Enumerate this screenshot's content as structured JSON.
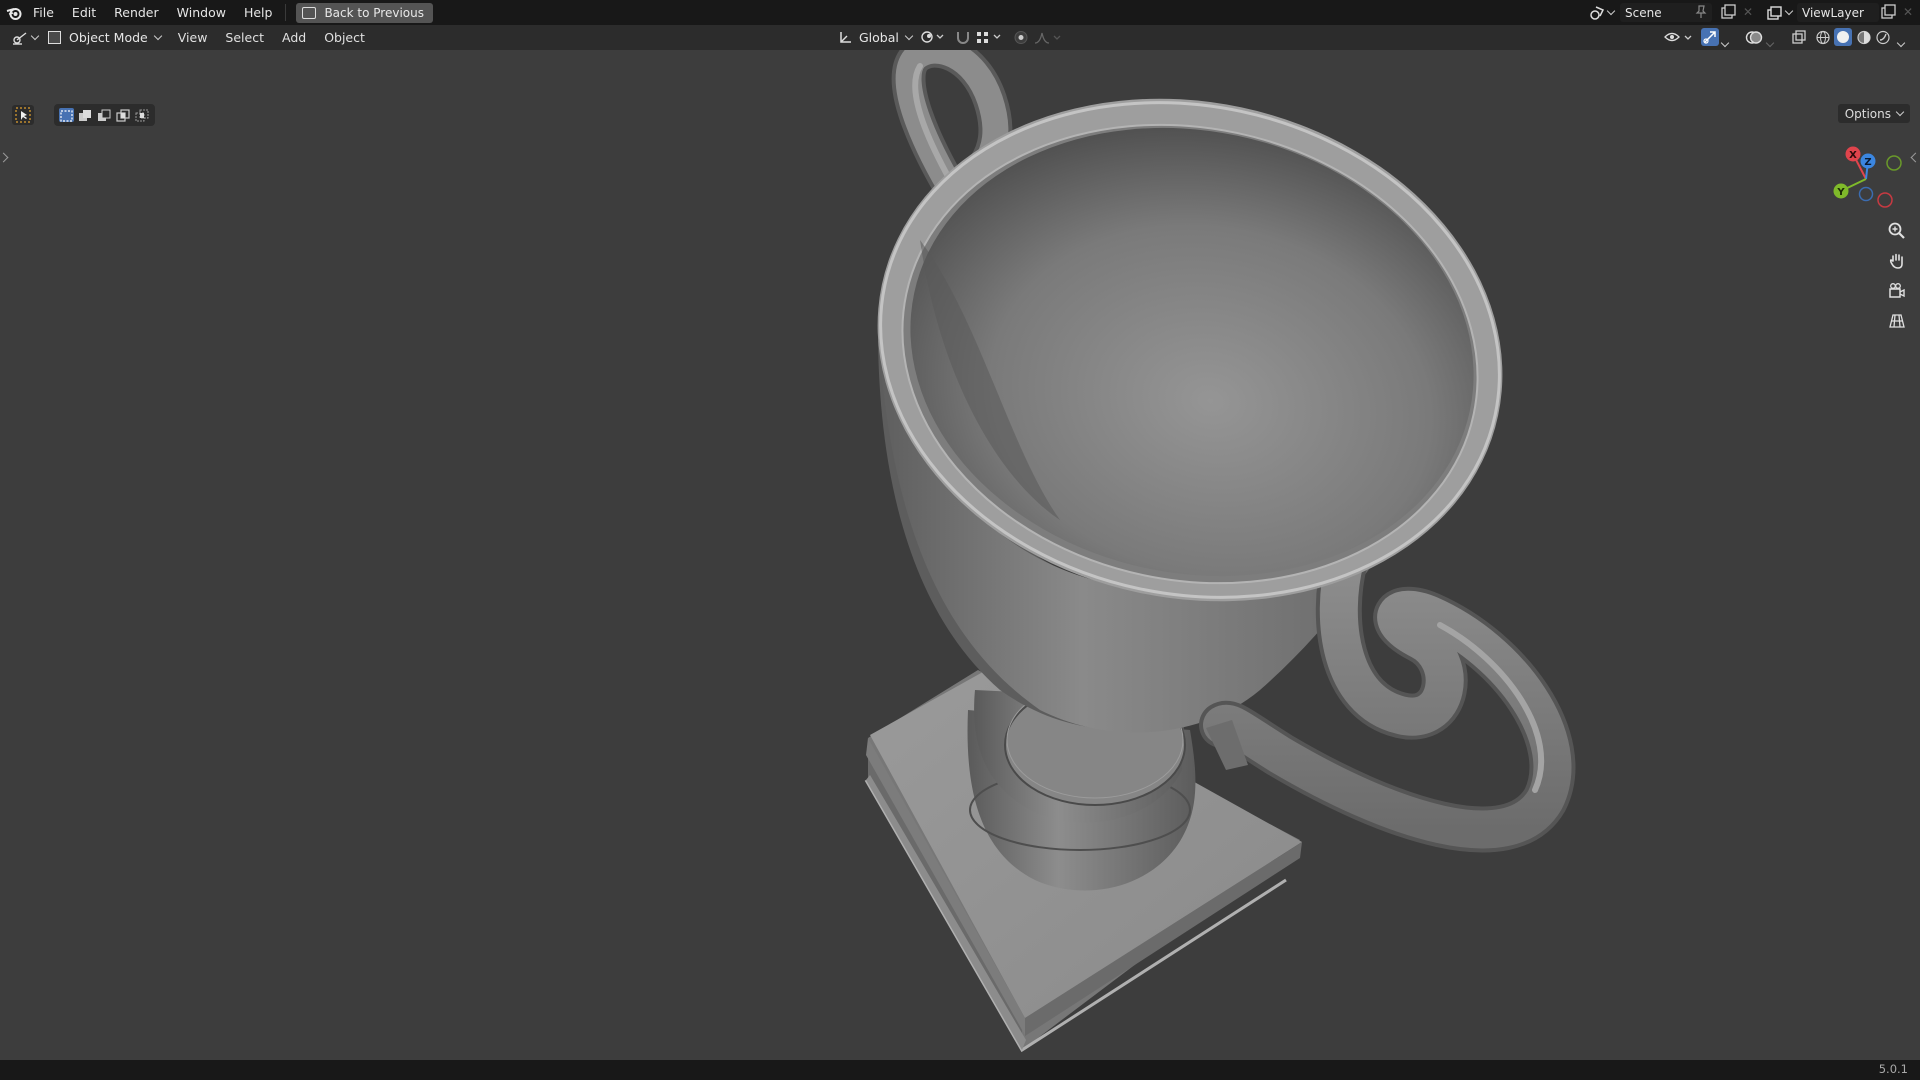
{
  "topbar": {
    "menus": [
      "File",
      "Edit",
      "Render",
      "Window",
      "Help"
    ],
    "back_button": "Back to Previous",
    "scene_name": "Scene",
    "view_layer_name": "ViewLayer"
  },
  "header": {
    "mode": "Object Mode",
    "menus": [
      "View",
      "Select",
      "Add",
      "Object"
    ],
    "transform_orientation": "Global"
  },
  "viewport": {
    "options_label": "Options",
    "gizmo_axes": [
      "X",
      "Y",
      "Z"
    ],
    "object": "trophy"
  },
  "status": {
    "version": "5.0.1"
  },
  "colors": {
    "axis_x": "#e0444c",
    "axis_y": "#7fba2a",
    "axis_z": "#3b86e0",
    "active_highlight": "#4772b3"
  }
}
